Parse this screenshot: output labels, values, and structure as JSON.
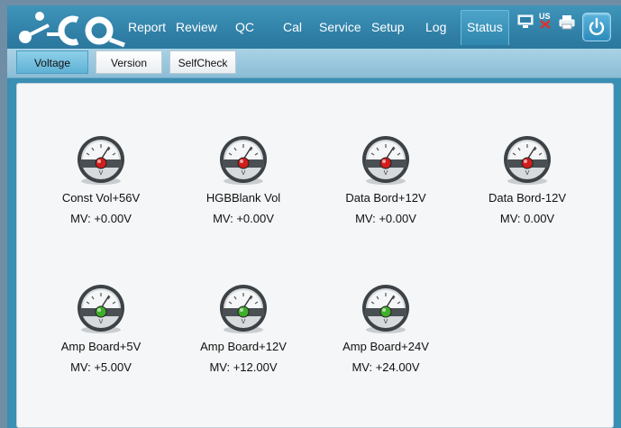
{
  "menu": {
    "items": [
      {
        "label": "Report",
        "active": false
      },
      {
        "label": "Review",
        "active": false
      },
      {
        "label": "QC",
        "active": false
      },
      {
        "label": "Cal",
        "active": false
      },
      {
        "label": "Service",
        "active": false
      },
      {
        "label": "Setup",
        "active": false
      },
      {
        "label": "Log",
        "active": false
      },
      {
        "label": "Status",
        "active": true
      }
    ],
    "lang_label": "US"
  },
  "subtabs": [
    {
      "label": "Voltage",
      "selected": true
    },
    {
      "label": "Version",
      "selected": false
    },
    {
      "label": "SelfCheck",
      "selected": false
    }
  ],
  "gauges": [
    {
      "name": "Const Vol+56V",
      "value": "MV: +0.00V",
      "status": "red"
    },
    {
      "name": "HGBBlank Vol",
      "value": "MV: +0.00V",
      "status": "red"
    },
    {
      "name": "Data Bord+12V",
      "value": "MV: +0.00V",
      "status": "red"
    },
    {
      "name": "Data Bord-12V",
      "value": "MV: 0.00V",
      "status": "red"
    },
    {
      "name": "Amp Board+5V",
      "value": "MV: +5.00V",
      "status": "green"
    },
    {
      "name": "Amp Board+12V",
      "value": "MV: +12.00V",
      "status": "green"
    },
    {
      "name": "Amp Board+24V",
      "value": "MV: +24.00V",
      "status": "green"
    }
  ],
  "colors": {
    "red": "#d21d1d",
    "green": "#3fae2a",
    "accent": "#2f7ea5"
  }
}
